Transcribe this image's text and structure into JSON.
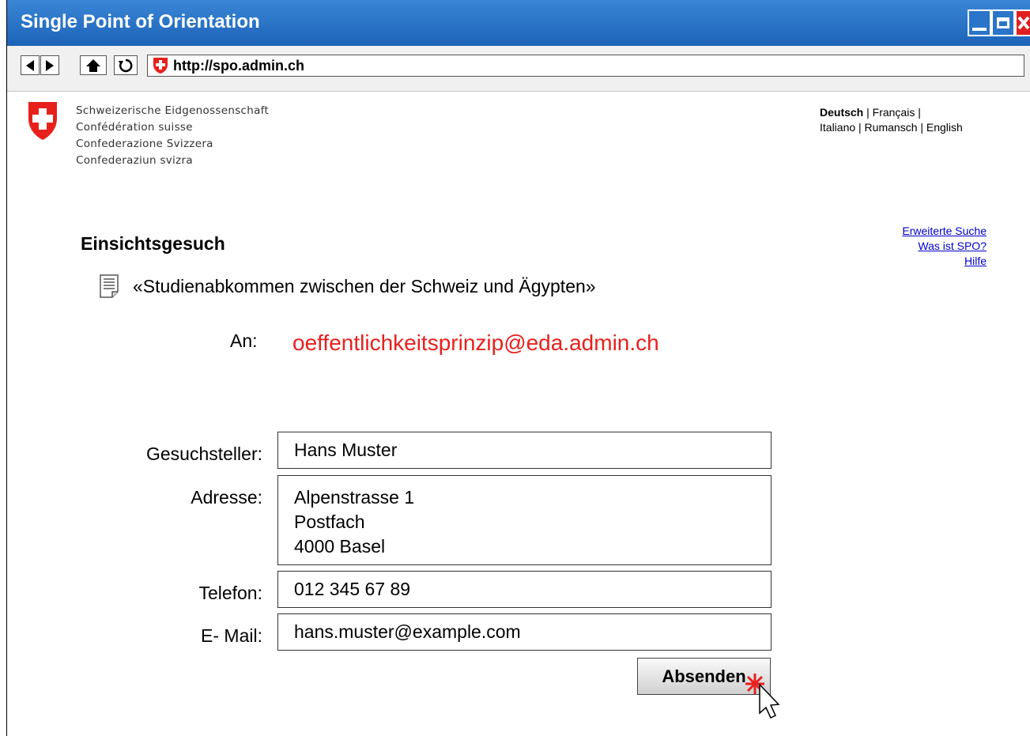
{
  "window": {
    "title": "Single Point of Orientation"
  },
  "browser": {
    "url": "http://spo.admin.ch"
  },
  "header": {
    "confederation_lines": [
      "Schweizerische Eidgenossenschaft",
      "Confédération suisse",
      "Confederazione Svizzera",
      "Confederaziun svizra"
    ],
    "languages": {
      "active": "Deutsch",
      "line1_rest": " | Français |",
      "line2": "Italiano | Rumansch | English"
    }
  },
  "side_links": [
    "Erweiterte Suche",
    "Was ist SPO?",
    "Hilfe"
  ],
  "page": {
    "title": "Einsichtsgesuch",
    "document_title": "«Studienabkommen zwischen der Schweiz und Ägypten»",
    "to_label": "An:",
    "to_value": "oeffentlichkeitsprinzip@eda.admin.ch"
  },
  "form": {
    "applicant": {
      "label": "Gesuchsteller:",
      "value": "Hans Muster"
    },
    "address": {
      "label": "Adresse:",
      "lines": [
        "Alpenstrasse 1",
        "Postfach",
        "4000 Basel"
      ]
    },
    "phone": {
      "label": "Telefon:",
      "value": "012 345 67 89"
    },
    "email": {
      "label": "E- Mail:",
      "value": "hans.muster@example.com"
    },
    "submit_label": "Absenden"
  },
  "colors": {
    "titlebar": "#2a74c9",
    "recipient": "#e8201c",
    "link": "#0000cc",
    "swiss_red": "#e8201c"
  }
}
